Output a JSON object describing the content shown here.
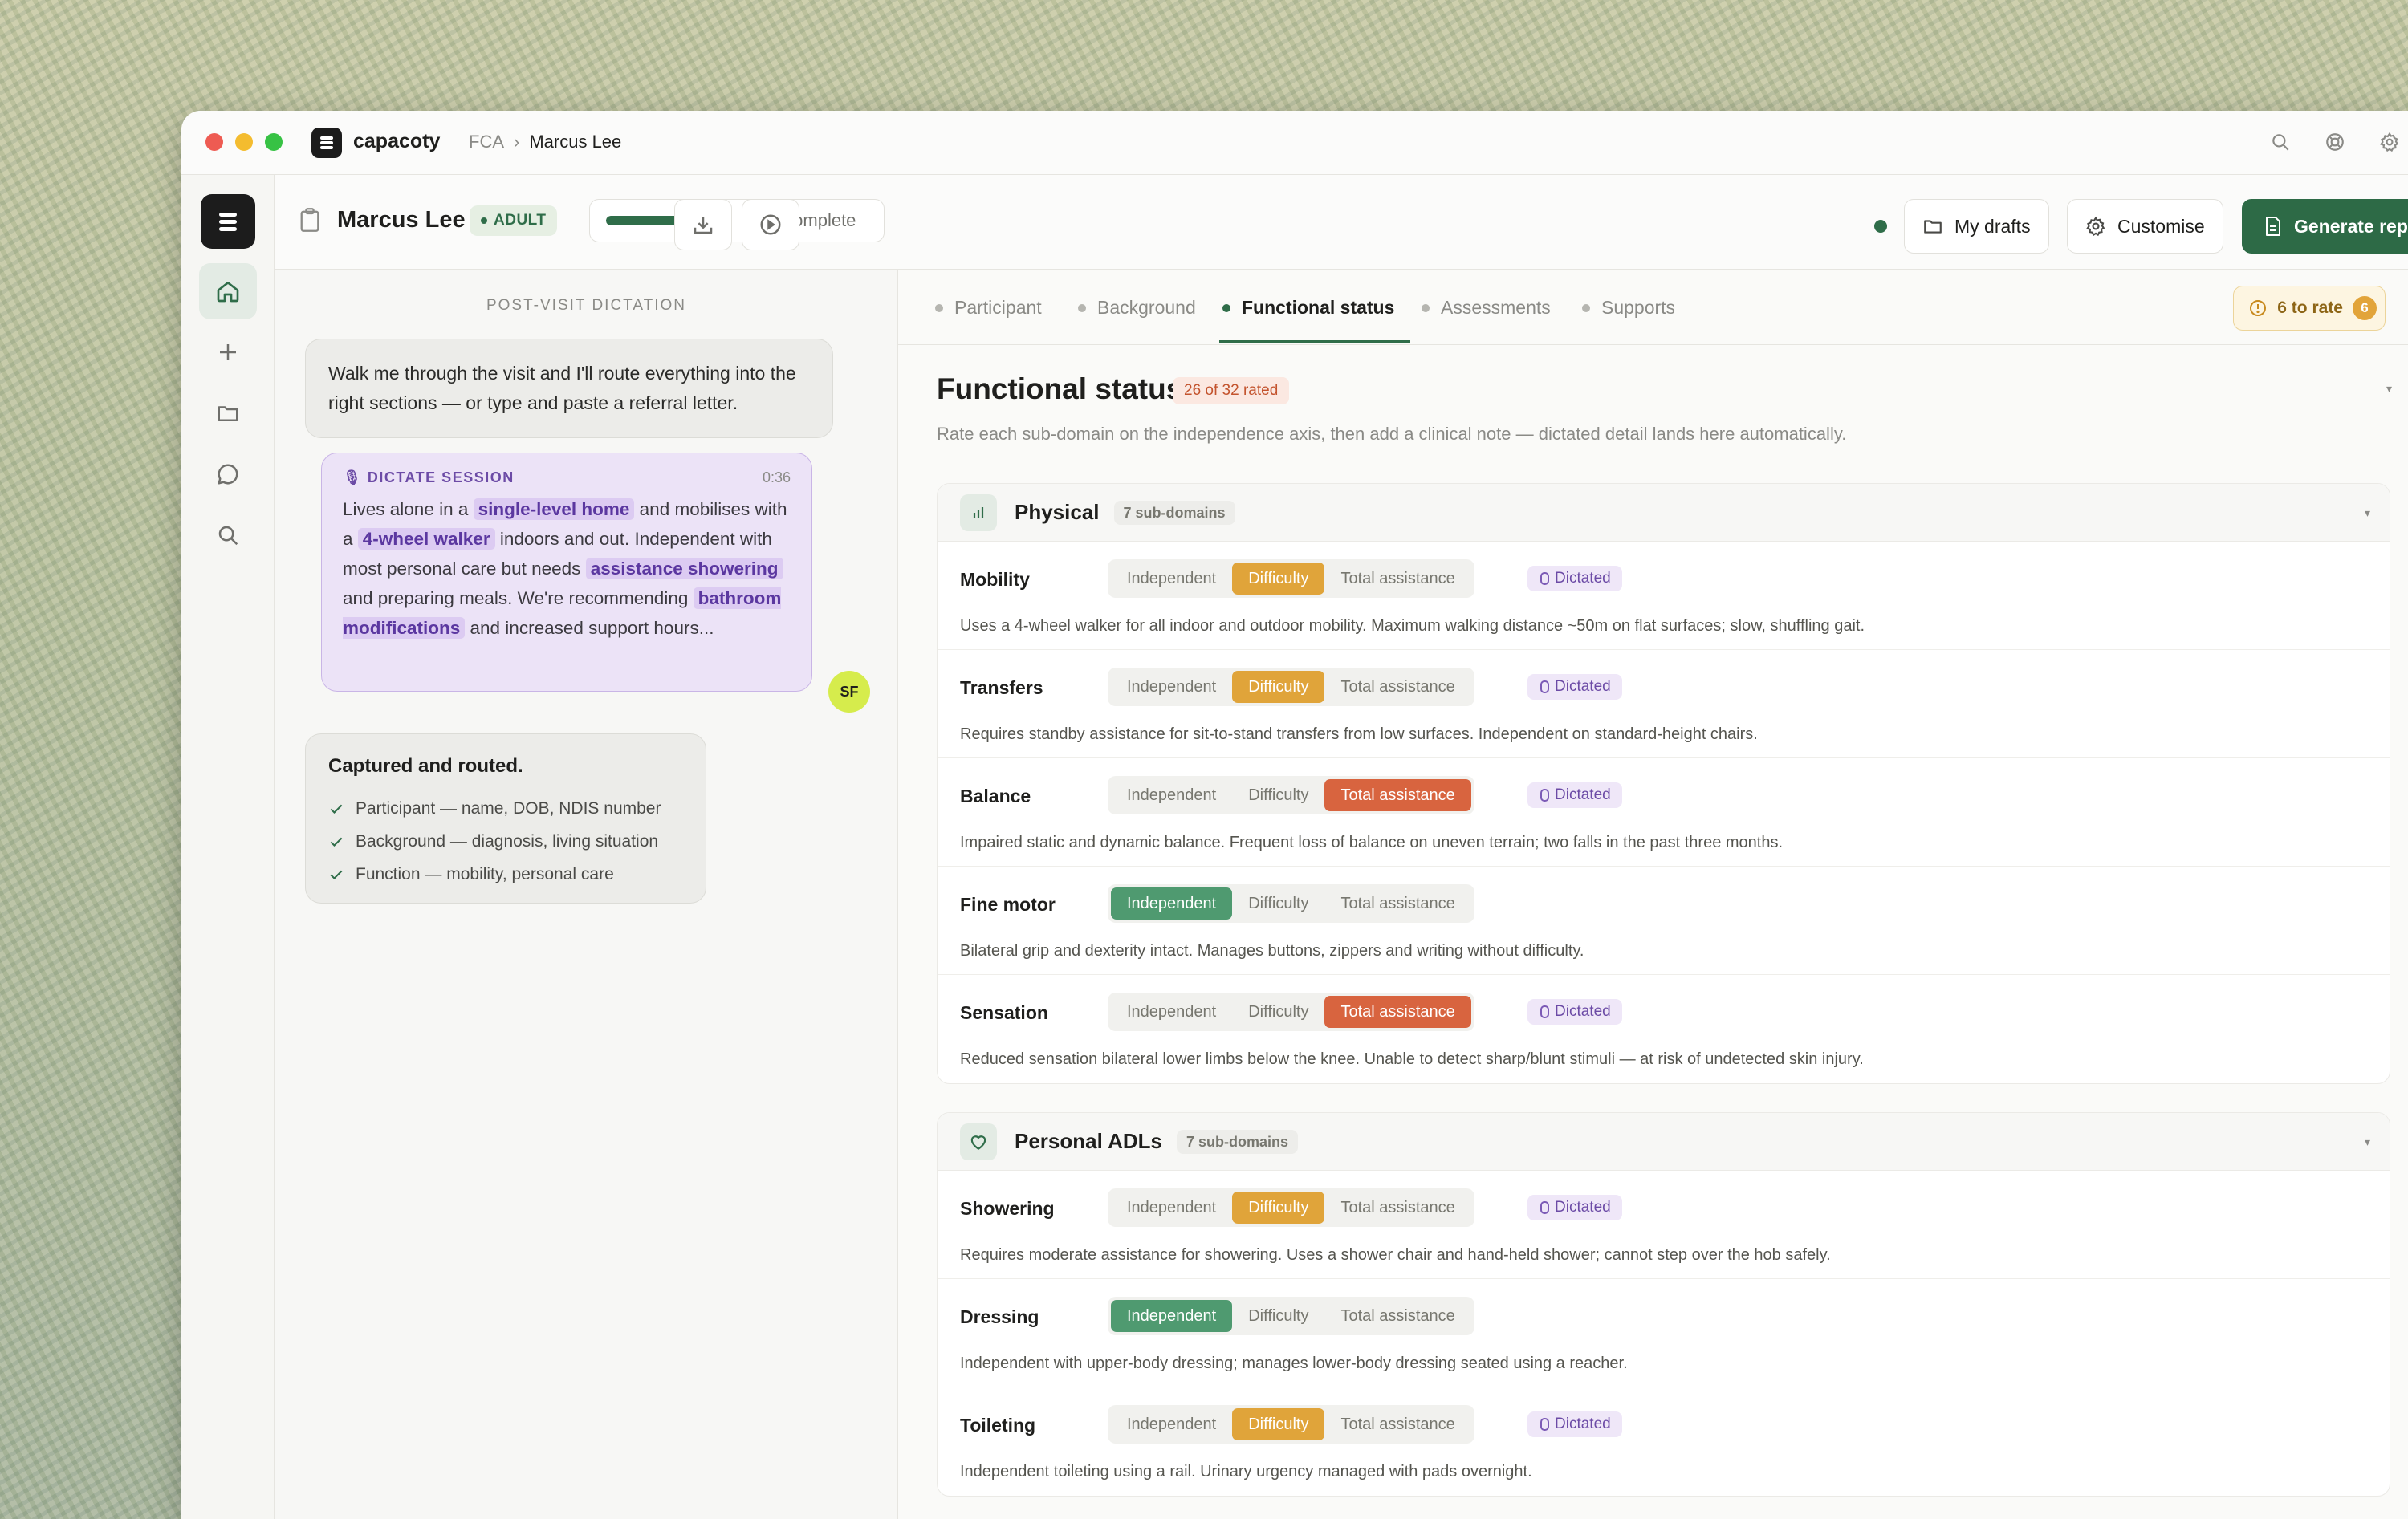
{
  "titlebar": {
    "brand": "capacoty",
    "breadcrumb": [
      "FCA",
      "Marcus Lee"
    ]
  },
  "header": {
    "participant_name": "Marcus Lee",
    "badge": "ADULT",
    "progress_percent": 75,
    "progress_text": "75% complete",
    "my_drafts": "My drafts",
    "customise": "Customise",
    "generate_report": "Generate report"
  },
  "dictation": {
    "section_title": "POST-VISIT DICTATION",
    "prompt": "Walk me through the visit and I'll route everything into the right sections — or type and paste a referral letter.",
    "session": {
      "label": "DICTATE SESSION",
      "time": "0:36",
      "parts": [
        {
          "text": "Lives alone in a ",
          "hl": false
        },
        {
          "text": "single-level home",
          "hl": true
        },
        {
          "text": " and mobilises with a ",
          "hl": false
        },
        {
          "text": "4-wheel walker",
          "hl": true
        },
        {
          "text": " indoors and out. Independent with most personal care but needs ",
          "hl": false
        },
        {
          "text": "assistance showering",
          "hl": true
        },
        {
          "text": " and preparing meals. We're recommending ",
          "hl": false
        },
        {
          "text": "bathroom modifications",
          "hl": true
        },
        {
          "text": " and increased support hours...",
          "hl": false
        }
      ]
    },
    "avatar": "SF",
    "captured": {
      "title": "Captured and routed.",
      "items": [
        "Participant — name, DOB, NDIS number",
        "Background — diagnosis, living situation",
        "Function — mobility, personal care"
      ]
    }
  },
  "tabs": [
    "Participant",
    "Background",
    "Functional status",
    "Assessments",
    "Supports"
  ],
  "active_tab": "Functional status",
  "to_rate": {
    "label": "6 to rate",
    "count": "6"
  },
  "functional": {
    "title": "Functional status",
    "rated": "26 of 32 rated",
    "description": "Rate each sub-domain on the independence axis, then add a clinical note — dictated detail lands here automatically."
  },
  "options": [
    "Independent",
    "Difficulty",
    "Total assistance"
  ],
  "dictated_label": "Dictated",
  "sections": [
    {
      "title": "Physical",
      "sub": "7 sub-domains",
      "icon": "bar-chart-icon",
      "rows": [
        {
          "label": "Mobility",
          "rating": "Difficulty",
          "dictated": true,
          "note": "Uses a 4-wheel walker for all indoor and outdoor mobility. Maximum walking distance ~50m on flat surfaces; slow, shuffling gait."
        },
        {
          "label": "Transfers",
          "rating": "Difficulty",
          "dictated": true,
          "note": "Requires standby assistance for sit-to-stand transfers from low surfaces. Independent on standard-height chairs."
        },
        {
          "label": "Balance",
          "rating": "Total assistance",
          "dictated": true,
          "note": "Impaired static and dynamic balance. Frequent loss of balance on uneven terrain; two falls in the past three months."
        },
        {
          "label": "Fine motor",
          "rating": "Independent",
          "dictated": false,
          "note": "Bilateral grip and dexterity intact. Manages buttons, zippers and writing without difficulty."
        },
        {
          "label": "Sensation",
          "rating": "Total assistance",
          "dictated": true,
          "note": "Reduced sensation bilateral lower limbs below the knee. Unable to detect sharp/blunt stimuli — at risk of undetected skin injury."
        }
      ]
    },
    {
      "title": "Personal ADLs",
      "sub": "7 sub-domains",
      "icon": "heart-icon",
      "rows": [
        {
          "label": "Showering",
          "rating": "Difficulty",
          "dictated": true,
          "note": "Requires moderate assistance for showering. Uses a shower chair and hand-held shower; cannot step over the hob safely."
        },
        {
          "label": "Dressing",
          "rating": "Independent",
          "dictated": false,
          "note": "Independent with upper-body dressing; manages lower-body dressing seated using a reacher."
        },
        {
          "label": "Toileting",
          "rating": "Difficulty",
          "dictated": true,
          "note": "Independent toileting using a rail. Urinary urgency managed with pads overnight."
        }
      ]
    }
  ],
  "colors": {
    "accent": "#2d6a46",
    "difficulty": "#e0a43a",
    "total_assistance": "#d8643f",
    "independent": "#4f9a70",
    "dictated": "#6c4ba6"
  }
}
